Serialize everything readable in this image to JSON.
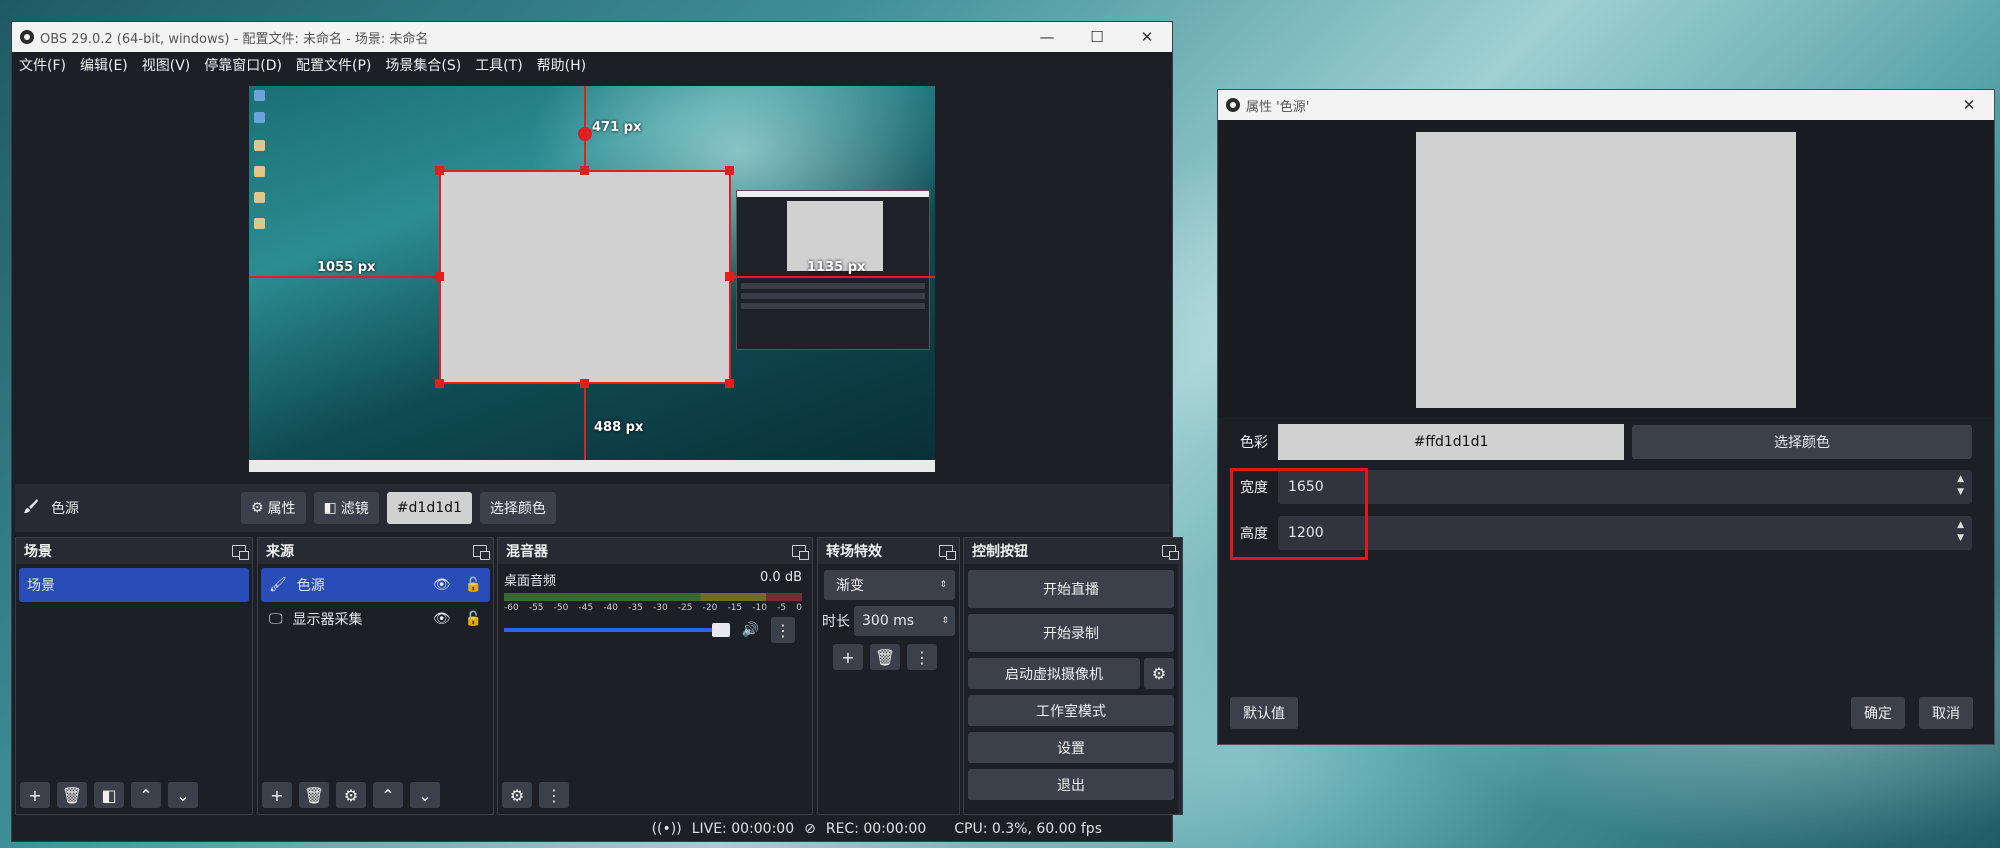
{
  "main_window": {
    "title": "OBS 29.0.2 (64-bit, windows) - 配置文件: 未命名 - 场景: 未命名",
    "window_buttons": {
      "minimize": "—",
      "maximize": "☐",
      "close": "✕"
    },
    "menu": [
      "文件(F)",
      "编辑(E)",
      "视图(V)",
      "停靠窗口(D)",
      "配置文件(P)",
      "场景集合(S)",
      "工具(T)",
      "帮助(H)"
    ],
    "preview": {
      "dist_top": "471 px",
      "dist_left": "1055 px",
      "dist_right": "1135 px",
      "dist_bottom": "488 px",
      "color_source_fill": "#d1d1d1"
    },
    "source_toolbar": {
      "source_name": "色源",
      "properties_label": "属性",
      "filters_label": "滤镜",
      "color_value": "#d1d1d1",
      "pick_color_label": "选择颜色"
    },
    "scenes": {
      "title": "场景",
      "items": [
        "场景"
      ]
    },
    "sources": {
      "title": "来源",
      "items": [
        "色源",
        "显示器采集"
      ]
    },
    "mixer": {
      "title": "混音器",
      "track_name": "桌面音频",
      "level": "0.0 dB",
      "scale": [
        "-60",
        "-55",
        "-50",
        "-45",
        "-40",
        "-35",
        "-30",
        "-25",
        "-20",
        "-15",
        "-10",
        "-5",
        "0"
      ]
    },
    "transitions": {
      "title": "转场特效",
      "type": "渐变",
      "duration_label": "时长",
      "duration_value": "300 ms"
    },
    "controls": {
      "title": "控制按钮",
      "start_stream": "开始直播",
      "start_record": "开始录制",
      "start_vcam": "启动虚拟摄像机",
      "studio_mode": "工作室模式",
      "settings": "设置",
      "exit": "退出"
    },
    "status": {
      "live": "LIVE: 00:00:00",
      "rec": "REC: 00:00:00",
      "cpu": "CPU: 0.3%, 60.00 fps"
    }
  },
  "properties_dialog": {
    "title": "属性 '色源'",
    "color_label": "色彩",
    "color_value": "#ffd1d1d1",
    "pick_color_label": "选择颜色",
    "width_label": "宽度",
    "width_value": "1650",
    "height_label": "高度",
    "height_value": "1200",
    "defaults_label": "默认值",
    "ok_label": "确定",
    "cancel_label": "取消",
    "highlight_color": "#e01818"
  },
  "colors": {
    "accent": "#284cb8",
    "panel": "#272a33",
    "background": "#1d1f26",
    "guide": "#e02020"
  },
  "icons": [
    "obs-logo-icon",
    "brush-icon",
    "gear-icon",
    "filter-icon",
    "eye-icon",
    "lock-icon",
    "monitor-icon",
    "plus-icon",
    "trash-icon",
    "chevron-up-icon",
    "chevron-down-icon",
    "speaker-icon",
    "kebab-icon",
    "popout-icon"
  ]
}
